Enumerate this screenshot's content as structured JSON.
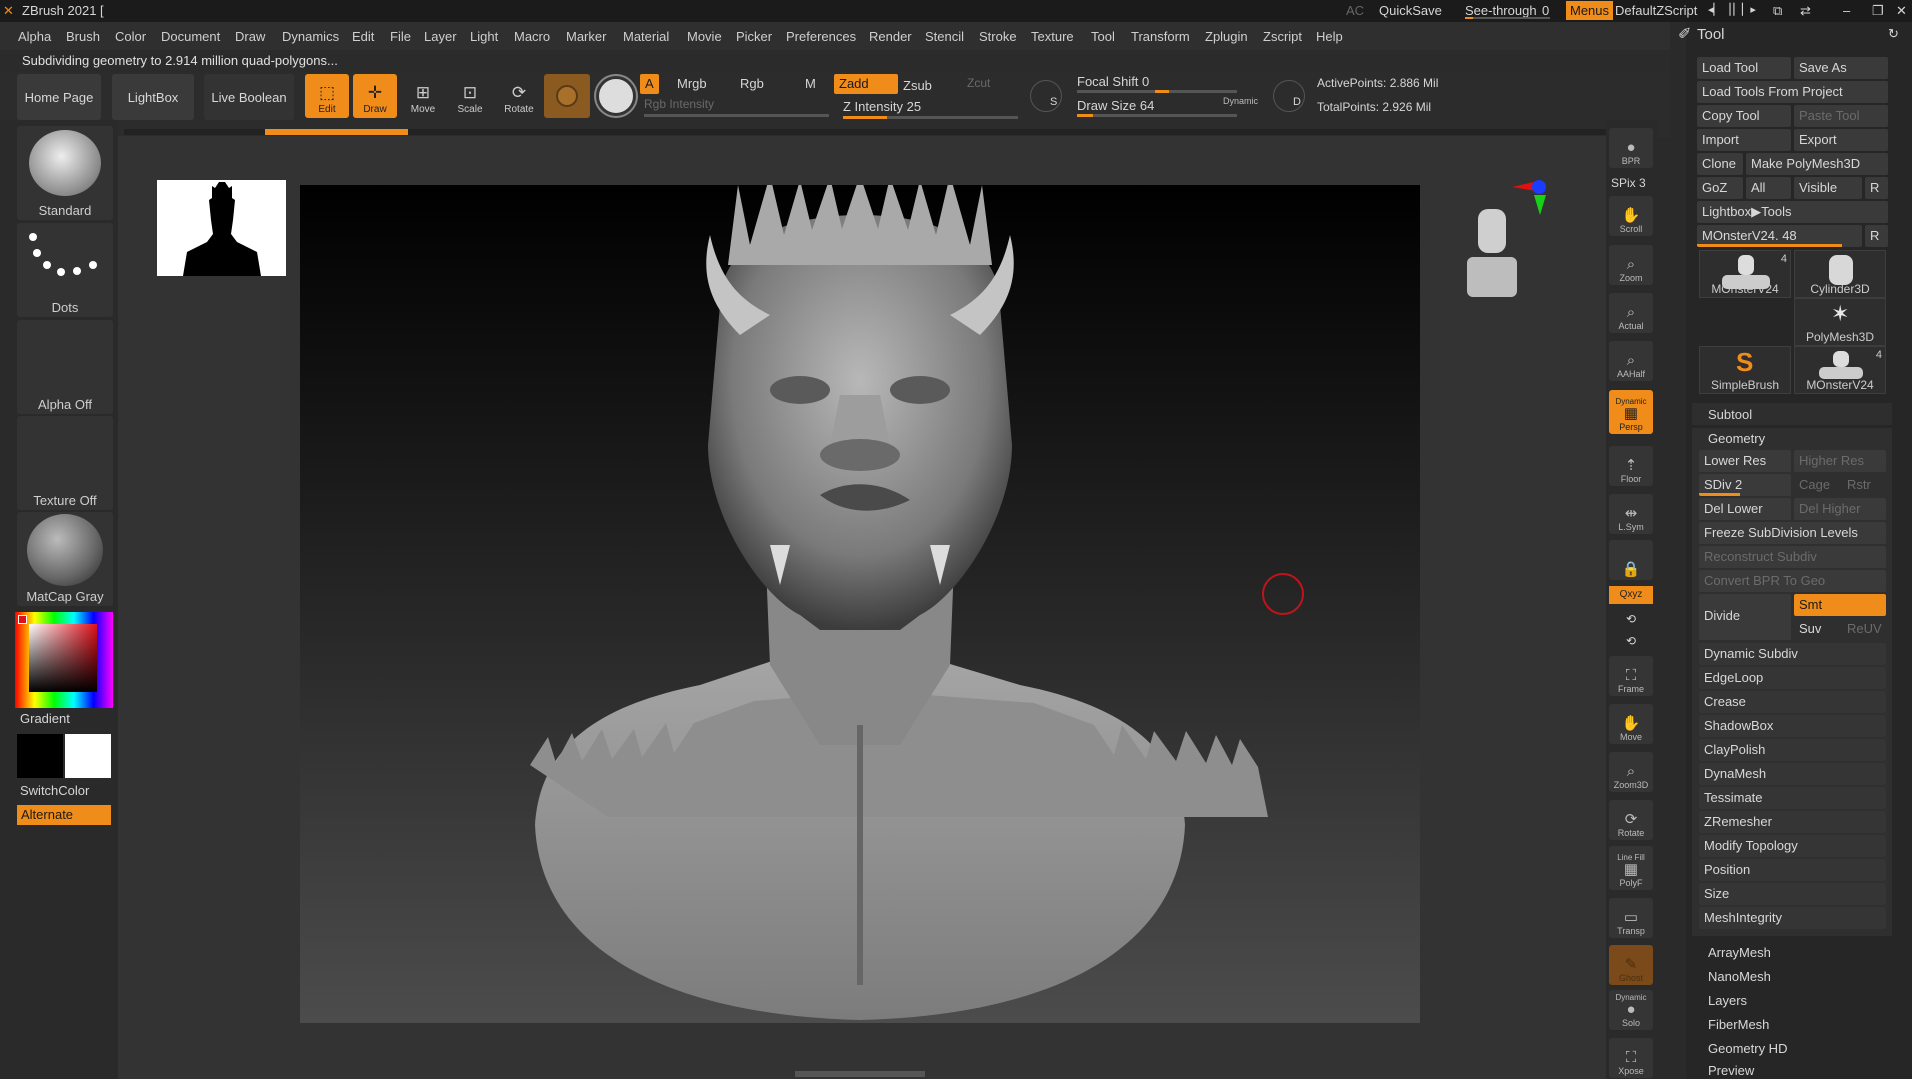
{
  "titlebar": {
    "app_title": "ZBrush 2021 [",
    "ac": "AC",
    "quicksave": "QuickSave",
    "seethrough": "See-through",
    "seethrough_value": "0",
    "menus": "Menus",
    "zscript": "DefaultZScript"
  },
  "menus": [
    "Alpha",
    "Brush",
    "Color",
    "Document",
    "Draw",
    "Dynamics",
    "Edit",
    "File",
    "Layer",
    "Light",
    "Macro",
    "Marker",
    "Material",
    "Movie",
    "Picker",
    "Preferences",
    "Render",
    "Stencil",
    "Stroke",
    "Texture",
    "Tool",
    "Transform",
    "Zplugin",
    "Zscript",
    "Help"
  ],
  "status": "Subdividing geometry to 2.914 million quad-polygons...",
  "nav": {
    "home": "Home Page",
    "lightbox": "LightBox",
    "liveboolean": "Live Boolean"
  },
  "tools": {
    "edit": "Edit",
    "draw": "Draw",
    "move": "Move",
    "scale": "Scale",
    "rotate": "Rotate"
  },
  "shelf": {
    "a": "A",
    "mrgb": "Mrgb",
    "rgb": "Rgb",
    "m": "M",
    "rgb_intensity": "Rgb Intensity",
    "zadd": "Zadd",
    "zsub": "Zsub",
    "zcut": "Zcut",
    "z_intensity_label": "Z Intensity",
    "z_intensity": "25",
    "z_intensity_pct": 0.25,
    "focal_label": "Focal Shift",
    "focal": "0",
    "drawsize_label": "Draw Size",
    "drawsize": "64",
    "drawsize_pct": 0.1,
    "dynamic": "Dynamic",
    "s_label": "S",
    "d_label": "D",
    "active_points": "ActivePoints: 2.886 Mil",
    "total_points": "TotalPoints: 2.926 Mil"
  },
  "left": {
    "brush": "Standard",
    "stroke": "Dots",
    "alpha": "Alpha Off",
    "texture": "Texture Off",
    "material": "MatCap Gray",
    "gradient": "Gradient",
    "switchcolor": "SwitchColor",
    "alternate": "Alternate"
  },
  "right": {
    "bpr": "BPR",
    "spix": "SPix 3",
    "scroll": "Scroll",
    "zoom": "Zoom",
    "actual": "Actual",
    "aahalf": "AAHalf",
    "dynamic": "Dynamic",
    "persp": "Persp",
    "floor": "Floor",
    "lsym": "L.Sym",
    "xyz": "Qxyz",
    "frame": "Frame",
    "move": "Move",
    "zoom3d": "Zoom3D",
    "rotate": "Rotate",
    "linefill": "Line Fill",
    "polyf": "PolyF",
    "transp": "Transp",
    "ghost": "Ghost",
    "solo": "Solo",
    "xpose": "Xpose"
  },
  "toolpanel": {
    "title": "Tool",
    "load_tool": "Load Tool",
    "save_as": "Save As",
    "load_from_project": "Load Tools From Project",
    "copy_tool": "Copy Tool",
    "paste_tool": "Paste Tool",
    "import": "Import",
    "export": "Export",
    "clone": "Clone",
    "make_polymesh": "Make PolyMesh3D",
    "goz": "GoZ",
    "all": "All",
    "visible": "Visible",
    "r": "R",
    "lightbox_tools": "Lightbox▶Tools",
    "current_tool": "MOnsterV24. 48",
    "current_tool_pct": 0.88,
    "r2": "R",
    "thumbs": [
      {
        "name": "MOnsterV24",
        "count": "4"
      },
      {
        "name": "Cylinder3D",
        "count": ""
      },
      {
        "name": "PolyMesh3D",
        "count": ""
      },
      {
        "name": "SimpleBrush",
        "count": ""
      },
      {
        "name": "MOnsterV24",
        "count": "4"
      }
    ],
    "subtool": "Subtool",
    "geometry": "Geometry",
    "lower_res": "Lower Res",
    "higher_res": "Higher Res",
    "sdiv": "SDiv 2",
    "sdiv_pct": 0.45,
    "cage": "Cage",
    "rstr": "Rstr",
    "del_lower": "Del Lower",
    "del_higher": "Del Higher",
    "freeze": "Freeze SubDivision Levels",
    "reconstruct": "Reconstruct Subdiv",
    "convert_bpr": "Convert BPR To Geo",
    "divide": "Divide",
    "smt": "Smt",
    "suv": "Suv",
    "reuv": "ReUV",
    "geo_items": [
      "Dynamic Subdiv",
      "EdgeLoop",
      "Crease",
      "ShadowBox",
      "ClayPolish",
      "DynaMesh",
      "Tessimate",
      "ZRemesher",
      "Modify Topology",
      "Position",
      "Size",
      "MeshIntegrity"
    ],
    "more_items": [
      "ArrayMesh",
      "NanoMesh",
      "Layers",
      "FiberMesh",
      "Geometry HD",
      "Preview"
    ]
  },
  "colors": {
    "accent": "#f08c1a",
    "bg": "#2a2a2a"
  }
}
